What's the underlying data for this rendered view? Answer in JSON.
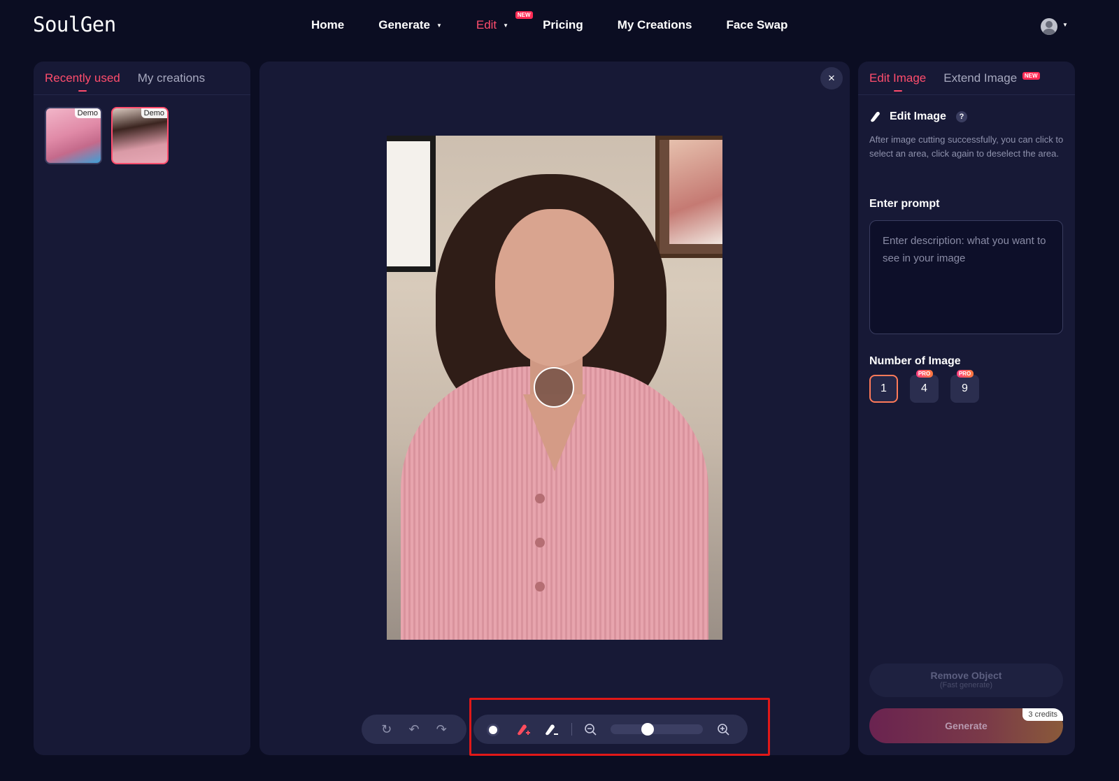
{
  "header": {
    "logo": "SoulGen",
    "nav": [
      {
        "label": "Home"
      },
      {
        "label": "Generate"
      },
      {
        "label": "Edit",
        "badge": "NEW"
      },
      {
        "label": "Pricing"
      },
      {
        "label": "My Creations"
      },
      {
        "label": "Face Swap"
      }
    ]
  },
  "left_panel": {
    "tabs": [
      "Recently used",
      "My creations"
    ],
    "thumbnails": [
      {
        "badge": "Demo"
      },
      {
        "badge": "Demo"
      }
    ]
  },
  "center": {
    "close_icon": "×",
    "brush_size_fraction": 0.4
  },
  "right_panel": {
    "tabs": [
      {
        "label": "Edit Image"
      },
      {
        "label": "Extend Image",
        "badge": "NEW"
      }
    ],
    "edit_title": "Edit Image",
    "help": "?",
    "description": "After image cutting successfully, you can click to select an area, click again to deselect the area.",
    "prompt_label": "Enter prompt",
    "prompt_placeholder": "Enter description: what you want to see in your image",
    "number_label": "Number of Image",
    "number_options": [
      {
        "value": "1"
      },
      {
        "value": "4",
        "badge": "PRO"
      },
      {
        "value": "9",
        "badge": "PRO"
      }
    ],
    "remove_label": "Remove Object",
    "remove_sub": "(Fast generate)",
    "generate_label": "Generate",
    "credits": "3 credits"
  },
  "colors": {
    "accent": "#ff4d6d",
    "background": "#0b0d22",
    "panel": "#171936",
    "highlight": "#e01818"
  }
}
